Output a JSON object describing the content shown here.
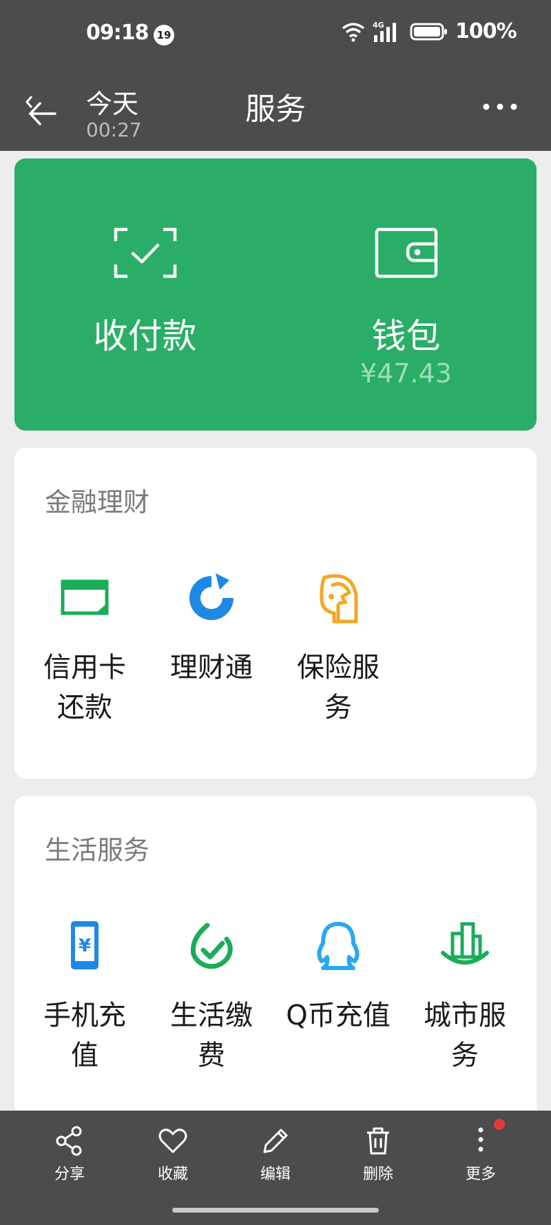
{
  "status_bar": {
    "time": "09:18",
    "notification_count": "19",
    "network": "4G",
    "battery": "100%"
  },
  "header": {
    "day": "今天",
    "time": "00:27",
    "title": "服务"
  },
  "top_card": {
    "pay_label": "收付款",
    "wallet_label": "钱包",
    "wallet_balance": "¥47.43",
    "color": "#2aae67"
  },
  "finance": {
    "title": "金融理财",
    "items": [
      {
        "line1": "信用卡",
        "line2": "还款",
        "icon": "credit-card-icon"
      },
      {
        "line1": "理财通",
        "line2": "",
        "icon": "licaitong-icon"
      },
      {
        "line1": "保险服",
        "line2": "务",
        "icon": "insurance-icon"
      }
    ]
  },
  "life": {
    "title": "生活服务",
    "items": [
      {
        "line1": "手机充",
        "line2": "值",
        "icon": "phone-recharge-icon"
      },
      {
        "line1": "生活缴",
        "line2": "费",
        "icon": "utility-payment-icon"
      },
      {
        "line1": "Q币充值",
        "line2": "",
        "icon": "qq-coin-icon"
      },
      {
        "line1": "城市服",
        "line2": "务",
        "icon": "city-service-icon"
      }
    ]
  },
  "toolbar": {
    "share": "分享",
    "favorite": "收藏",
    "edit": "编辑",
    "delete": "删除",
    "more": "更多"
  }
}
